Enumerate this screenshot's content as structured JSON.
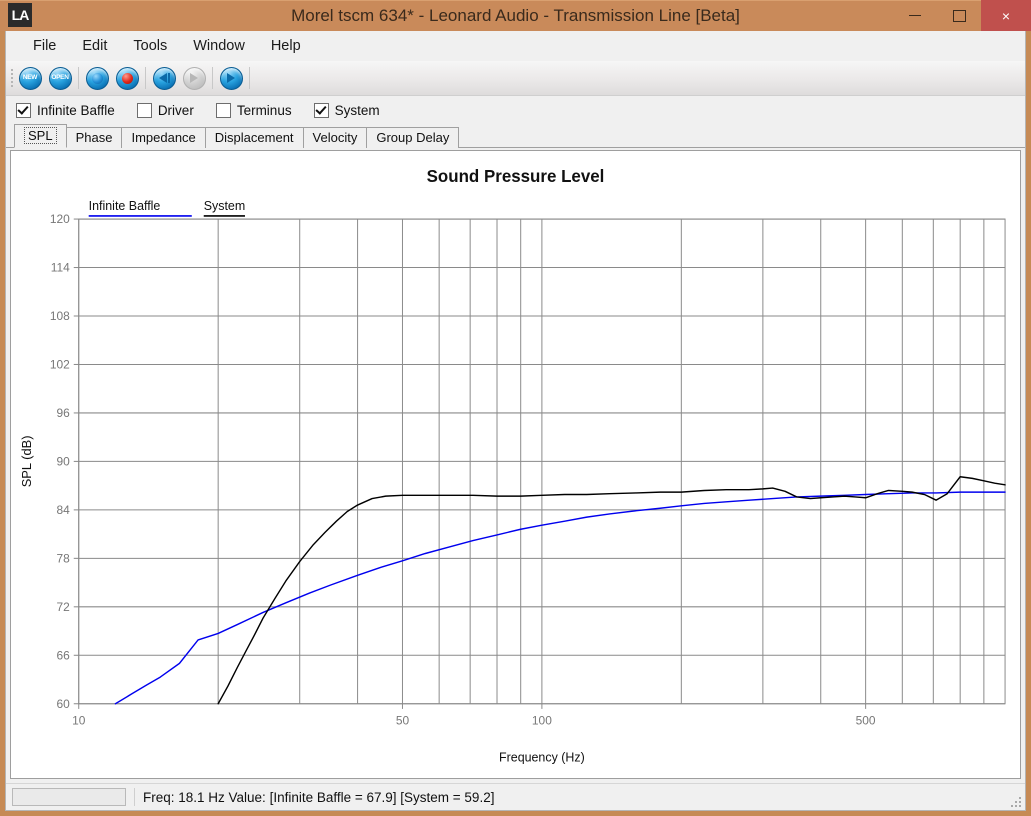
{
  "window": {
    "title": "Morel tscm  634* - Leonard Audio - Transmission Line [Beta]",
    "app_icon": "LA",
    "accent_color": "#c68a55",
    "close_color": "#c0504d",
    "minimize_label": "minimize",
    "maximize_label": "maximize",
    "close_label": "×"
  },
  "menu": {
    "items": [
      {
        "label": "File"
      },
      {
        "label": "Edit"
      },
      {
        "label": "Tools"
      },
      {
        "label": "Window"
      },
      {
        "label": "Help"
      }
    ]
  },
  "toolbar": {
    "buttons": [
      {
        "name": "new-button",
        "icon": "new-icon",
        "label": "NEW"
      },
      {
        "name": "open-button",
        "icon": "open-icon",
        "label": "OPEN"
      },
      {
        "name": "calculate-button",
        "icon": "blue-orb-icon",
        "label": ""
      },
      {
        "name": "stop-button",
        "icon": "red-orb-icon",
        "label": ""
      },
      {
        "name": "previous-button",
        "icon": "step-back-icon",
        "label": ""
      },
      {
        "name": "next-button",
        "icon": "step-forward-icon",
        "label": ""
      },
      {
        "name": "run-button",
        "icon": "play-icon",
        "label": ""
      }
    ]
  },
  "checkboxes": [
    {
      "label": "Infinite Baffle",
      "checked": true
    },
    {
      "label": "Driver",
      "checked": false
    },
    {
      "label": "Terminus",
      "checked": false
    },
    {
      "label": "System",
      "checked": true
    }
  ],
  "tabs": {
    "active": "SPL",
    "items": [
      {
        "label": "SPL"
      },
      {
        "label": "Phase"
      },
      {
        "label": "Impedance"
      },
      {
        "label": "Displacement"
      },
      {
        "label": "Velocity"
      },
      {
        "label": "Group Delay"
      }
    ]
  },
  "statusbar": {
    "progress_value": "",
    "text": "Freq: 18.1 Hz   Value: [Infinite Baffle = 67.9]  [System = 59.2]",
    "freq_label": "Freq: 18.1 Hz",
    "value_label": "Value:",
    "infinite_baffle_value": "[Infinite Baffle = 67.9]",
    "system_value": "[System = 59.2]"
  },
  "chart_data": {
    "type": "line",
    "title": "Sound Pressure Level",
    "xlabel": "Frequency (Hz)",
    "ylabel": "SPL (dB)",
    "xscale": "log",
    "xlim": [
      10,
      1000
    ],
    "ylim": [
      60,
      120
    ],
    "yticks": [
      60,
      66,
      72,
      78,
      84,
      90,
      96,
      102,
      108,
      114,
      120
    ],
    "xticks_labeled": [
      10,
      50,
      100,
      500
    ],
    "xticks_minor": [
      20,
      30,
      40,
      60,
      70,
      80,
      90,
      200,
      300,
      400,
      600,
      700,
      800,
      900
    ],
    "grid": true,
    "legend_position": "top-left",
    "series": [
      {
        "name": "Infinite Baffle",
        "color": "#0000ee",
        "x": [
          12.0,
          13.0,
          14.0,
          15.0,
          16.5,
          18.1,
          20.0,
          22.0,
          25.0,
          28.0,
          31.5,
          35.0,
          40.0,
          45.0,
          50.0,
          56.0,
          63.0,
          71.0,
          80.0,
          90.0,
          100.0,
          112.0,
          125.0,
          140.0,
          160.0,
          180.0,
          200.0,
          224.0,
          250.0,
          280.0,
          315.0,
          355.0,
          400.0,
          450.0,
          500.0,
          560.0,
          630.0,
          710.0,
          800.0,
          900.0,
          1000.0
        ],
        "y": [
          60.0,
          61.2,
          62.3,
          63.3,
          65.0,
          67.9,
          68.7,
          69.8,
          71.3,
          72.5,
          73.7,
          74.7,
          75.9,
          76.9,
          77.7,
          78.6,
          79.4,
          80.2,
          80.9,
          81.6,
          82.1,
          82.6,
          83.1,
          83.5,
          83.9,
          84.2,
          84.5,
          84.8,
          85.0,
          85.2,
          85.4,
          85.6,
          85.7,
          85.8,
          85.9,
          86.0,
          86.1,
          86.1,
          86.2,
          86.2,
          86.2
        ]
      },
      {
        "name": "System",
        "color": "#000000",
        "x": [
          20.0,
          21.0,
          22.0,
          23.0,
          24.0,
          25.0,
          26.5,
          28.0,
          30.0,
          32.0,
          34.0,
          36.0,
          38.0,
          40.0,
          43.0,
          46.0,
          50.0,
          56.0,
          63.0,
          71.0,
          80.0,
          90.0,
          100.0,
          112.0,
          125.0,
          140.0,
          160.0,
          180.0,
          200.0,
          224.0,
          250.0,
          280.0,
          300.0,
          315.0,
          335.0,
          355.0,
          380.0,
          400.0,
          425.0,
          450.0,
          475.0,
          500.0,
          530.0,
          560.0,
          600.0,
          630.0,
          670.0,
          710.0,
          750.0,
          800.0,
          850.0,
          900.0,
          950.0,
          1000.0
        ],
        "y": [
          60.0,
          62.2,
          64.5,
          66.6,
          68.6,
          70.6,
          73.0,
          75.2,
          77.6,
          79.6,
          81.2,
          82.6,
          83.8,
          84.6,
          85.4,
          85.7,
          85.8,
          85.8,
          85.8,
          85.8,
          85.7,
          85.7,
          85.8,
          85.9,
          85.9,
          86.0,
          86.1,
          86.2,
          86.2,
          86.4,
          86.5,
          86.5,
          86.6,
          86.7,
          86.3,
          85.6,
          85.4,
          85.5,
          85.6,
          85.7,
          85.6,
          85.5,
          86.0,
          86.4,
          86.3,
          86.2,
          85.9,
          85.2,
          86.0,
          88.1,
          87.9,
          87.6,
          87.3,
          87.1
        ]
      }
    ]
  }
}
